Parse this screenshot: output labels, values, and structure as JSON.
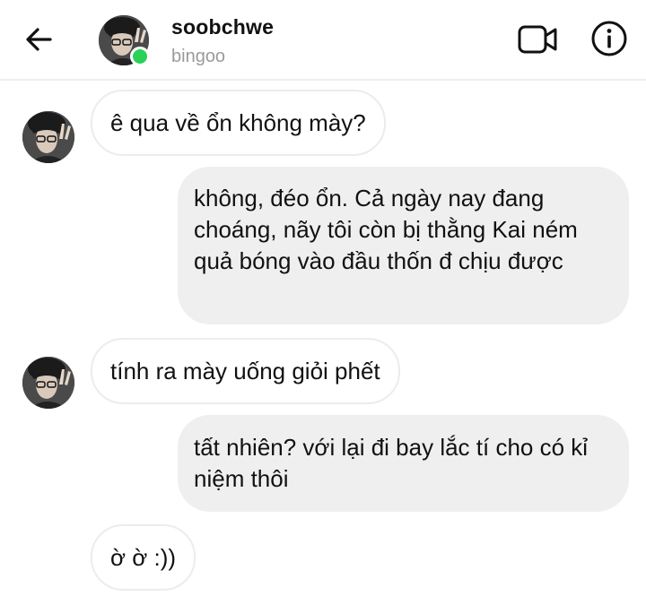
{
  "header": {
    "username": "soobchwe",
    "subname": "bingoo",
    "back_icon": "arrow-left-icon",
    "video_icon": "video-camera-icon",
    "info_icon": "info-circle-icon",
    "online_color": "#2bd157"
  },
  "messages": [
    {
      "direction": "incoming",
      "text": "ê qua về ổn không mày?"
    },
    {
      "direction": "outgoing",
      "text": "không, đéo ổn. Cả ngày nay đang choáng, nãy tôi còn bị thằng Kai ném quả bóng vào đầu thốn đ chịu được"
    },
    {
      "direction": "incoming",
      "text": "tính ra mày uống giỏi phết"
    },
    {
      "direction": "outgoing",
      "text": "tất nhiên? với lại đi bay lắc tí cho có kỉ niệm thôi"
    },
    {
      "direction": "incoming",
      "text": "ờ ờ :))"
    }
  ],
  "colors": {
    "outgoing_bubble": "#efefef",
    "incoming_border": "#ececec",
    "subtext": "#9a9a9a"
  }
}
